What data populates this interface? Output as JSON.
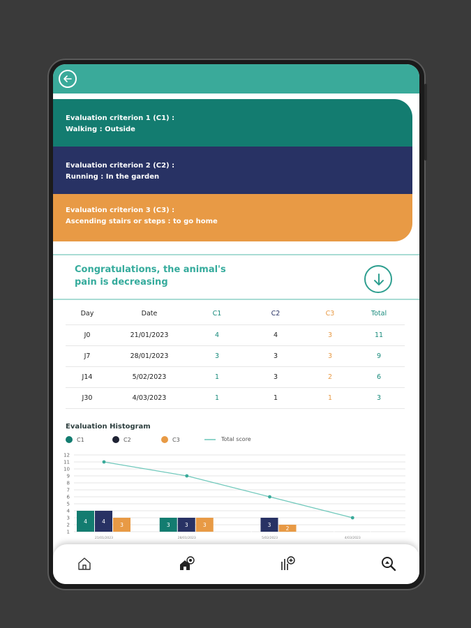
{
  "criteria": [
    {
      "title": "Evaluation criterion  1 (C1) :",
      "detail": "Walking : Outside"
    },
    {
      "title": "Evaluation criterion 2 (C2) :",
      "detail": "Running : In the garden"
    },
    {
      "title": "Evaluation criterion 3 (C3) :",
      "detail": "Ascending stairs or steps : to go home"
    }
  ],
  "message": "Congratulations, the animal's pain is decreasing",
  "table": {
    "headers": [
      "Day",
      "Date",
      "C1",
      "C2",
      "C3",
      "Total"
    ],
    "rows": [
      [
        "J0",
        "21/01/2023",
        "4",
        "4",
        "3",
        "11"
      ],
      [
        "J7",
        "28/01/2023",
        "3",
        "3",
        "3",
        "9"
      ],
      [
        "J14",
        "5/02/2023",
        "1",
        "3",
        "2",
        "6"
      ],
      [
        "J30",
        "4/03/2023",
        "1",
        "1",
        "1",
        "3"
      ]
    ]
  },
  "histogram": {
    "title": "Evaluation Histogram",
    "legend": [
      "C1",
      "C2",
      "C3",
      "Total score"
    ]
  },
  "colors": {
    "c1": "#137c70",
    "c2": "#283264",
    "c3": "#e89a45",
    "total": "#6fc8bb",
    "accent": "#3aaa9a"
  },
  "chart_data": {
    "type": "bar",
    "categories": [
      "21/01/2023",
      "28/01/2023",
      "5/02/2023",
      "4/03/2023"
    ],
    "series": [
      {
        "name": "C1",
        "values": [
          4,
          3,
          1,
          1
        ]
      },
      {
        "name": "C2",
        "values": [
          4,
          3,
          3,
          1
        ]
      },
      {
        "name": "C3",
        "values": [
          3,
          3,
          2,
          1
        ]
      }
    ],
    "line": {
      "name": "Total score",
      "values": [
        11,
        9,
        6,
        3
      ]
    },
    "yticks": [
      1,
      2,
      3,
      4,
      5,
      6,
      7,
      8,
      9,
      10,
      11,
      12
    ],
    "ylim": [
      1,
      12
    ],
    "grid": true
  },
  "icons": {
    "back": "arrow-left-icon",
    "down": "arrow-down-icon",
    "home": "home-icon",
    "pet": "pet-house-icon",
    "add": "chart-add-icon",
    "search": "search-pet-icon"
  }
}
